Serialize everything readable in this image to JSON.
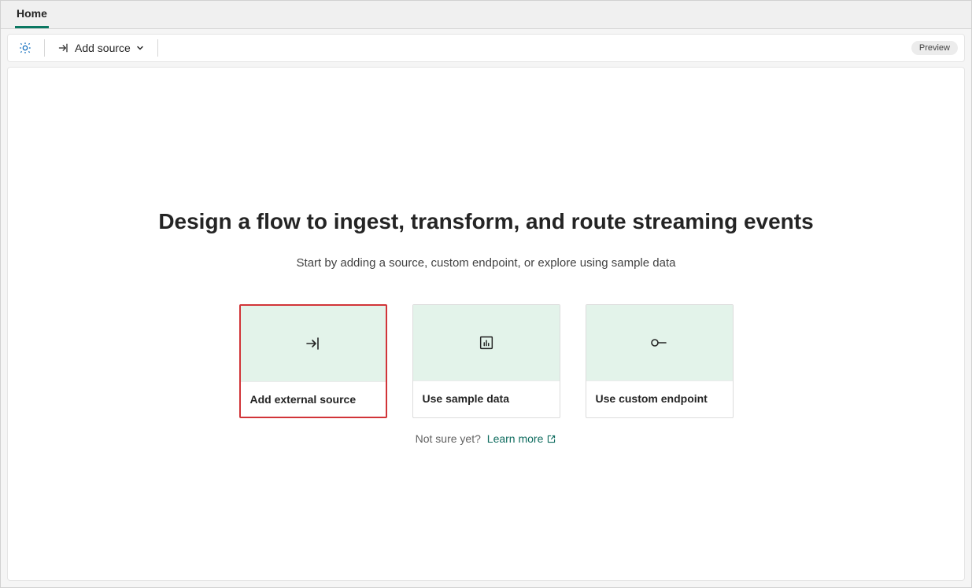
{
  "tabs": {
    "home": "Home"
  },
  "toolbar": {
    "add_source_label": "Add source",
    "preview_badge": "Preview"
  },
  "hero": {
    "title": "Design a flow to ingest, transform, and route streaming events",
    "subtitle": "Start by adding a source, custom endpoint, or explore using sample data"
  },
  "cards": {
    "add_external_source": "Add external source",
    "use_sample_data": "Use sample data",
    "use_custom_endpoint": "Use custom endpoint"
  },
  "footer": {
    "not_sure": "Not sure yet?",
    "learn_more": "Learn more"
  },
  "colors": {
    "accent_teal": "#0b7862",
    "highlight_red": "#d13438",
    "card_icon_bg": "#e3f3ea"
  }
}
